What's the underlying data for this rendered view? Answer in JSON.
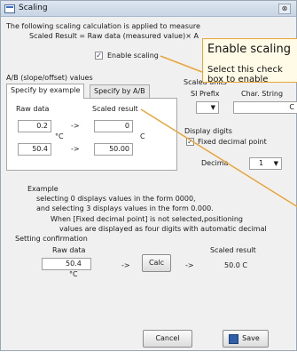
{
  "window": {
    "title": "Scaling",
    "close_label": "⊗"
  },
  "intro": {
    "line1": "The following scaling calculation is applied to measure",
    "line2": "Scaled Result = Raw data (measured value)× A"
  },
  "enable_scaling": {
    "label": "Enable scaling",
    "checked": true
  },
  "ab_group": {
    "title": "A/B (slope/offset) values",
    "tabs": [
      {
        "label": "Specify by example"
      },
      {
        "label": "Specify by A/B"
      }
    ],
    "raw_header": "Raw data",
    "scaled_header": "Scaled result",
    "rows": [
      {
        "raw": "0.2",
        "scaled": "0"
      },
      {
        "raw": "50.4",
        "scaled": "50.00"
      }
    ],
    "raw_unit": "°C",
    "scaled_unit": "C",
    "arrow": "->"
  },
  "scaled_units": {
    "title": "Scaled units",
    "si_prefix_label": "SI Prefix",
    "char_string_label": "Char. String",
    "char_string_value": "C"
  },
  "display_digits": {
    "title": "Display digits",
    "fixed_label": "Fixed decimal point",
    "fixed_checked": true,
    "decimal_label": "Decima",
    "decimal_value": "1"
  },
  "example": {
    "title": "Example",
    "line1": "selecting 0 displays values in the form 0000,",
    "line2": "and selecting 3 displays values in the form 0.000.",
    "line3": "When [Fixed decimal point] is not selected,positioning",
    "line4": "values are displayed as four digits with automatic decimal"
  },
  "confirmation": {
    "title": "Setting confirmation",
    "raw_label": "Raw data",
    "raw_value": "50.4",
    "raw_unit": "°C",
    "calc_label": "Calc",
    "scaled_label": "Scaled result",
    "scaled_value": "50.0 C",
    "arrow": "->"
  },
  "buttons": {
    "cancel": "Cancel",
    "save": "Save"
  },
  "tooltip": {
    "title": "Enable scaling",
    "description": "Select this check box to enable scaling."
  }
}
